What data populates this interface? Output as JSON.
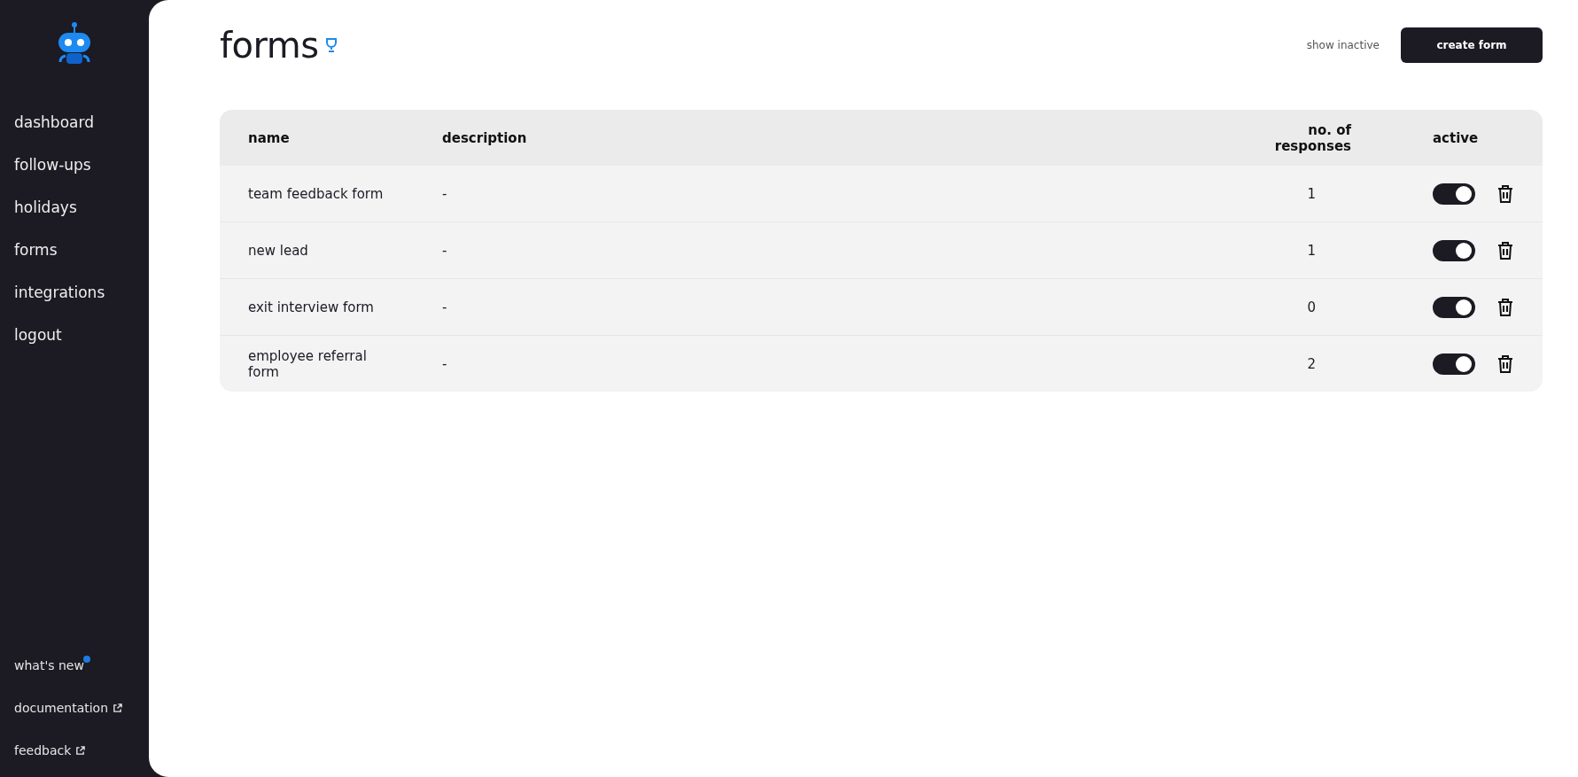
{
  "sidebar": {
    "items": [
      {
        "label": "dashboard"
      },
      {
        "label": "follow-ups"
      },
      {
        "label": "holidays"
      },
      {
        "label": "forms"
      },
      {
        "label": "integrations"
      },
      {
        "label": "logout"
      }
    ],
    "bottom_items": [
      {
        "label": "what's new",
        "kind": "new"
      },
      {
        "label": "documentation",
        "kind": "external"
      },
      {
        "label": "feedback",
        "kind": "external"
      }
    ]
  },
  "header": {
    "title": "forms",
    "toggle_link": "show inactive",
    "create_button": "create form"
  },
  "table": {
    "columns": [
      "name",
      "description",
      "no. of responses",
      "active"
    ],
    "rows": [
      {
        "name": "team feedback form",
        "description": "-",
        "responses": "1",
        "active": true
      },
      {
        "name": "new lead",
        "description": "-",
        "responses": "1",
        "active": true
      },
      {
        "name": "exit interview form",
        "description": "-",
        "responses": "0",
        "active": true
      },
      {
        "name": "employee referral form",
        "description": "-",
        "responses": "2",
        "active": true
      }
    ]
  }
}
